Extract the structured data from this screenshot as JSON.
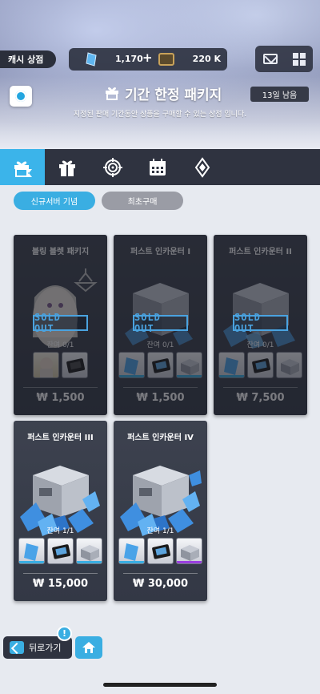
{
  "header": {
    "shop_label": "캐시 상점",
    "currency1_value": "1,170",
    "currency_plus": "+",
    "currency2_value": "220 K",
    "icons": [
      "mail-icon",
      "grid-menu-icon"
    ]
  },
  "title": {
    "text": "기간 한정 패키지",
    "subtitle": "지정된 판매 기간동안 상품을 구매할 수 있는 상점 입니다.",
    "days_left": "13일 남음"
  },
  "tabs": [
    {
      "icon": "limited-package-icon",
      "active": true
    },
    {
      "icon": "gift-icon",
      "active": false
    },
    {
      "icon": "target-icon",
      "active": false
    },
    {
      "icon": "calendar-icon",
      "active": false
    },
    {
      "icon": "diamond-icon",
      "active": false
    }
  ],
  "subtabs": {
    "active": "신규서버 기념",
    "inactive": "최초구매"
  },
  "cards": [
    {
      "title": "블링 블렛 패키지",
      "remaining": "잔여 0/1",
      "price": "₩ 1,500",
      "sold_out": true,
      "stamp": "SOLD OUT"
    },
    {
      "title": "퍼스트 인카운터 I",
      "remaining": "잔여 0/1",
      "price": "₩ 1,500",
      "sold_out": true,
      "stamp": "SOLD OUT"
    },
    {
      "title": "퍼스트 인카운터 II",
      "remaining": "잔여 0/1",
      "price": "₩ 7,500",
      "sold_out": true,
      "stamp": "SOLD OUT"
    },
    {
      "title": "퍼스트 인카운터 III",
      "remaining": "잔여  1/1",
      "price": "₩ 15,000",
      "sold_out": false
    },
    {
      "title": "퍼스트 인카운터 IV",
      "remaining": "잔여  1/1",
      "price": "₩ 30,000",
      "sold_out": false
    }
  ],
  "bottom": {
    "back_label": "뒤로가기",
    "alert": "!"
  },
  "colors": {
    "accent": "#3aaee2",
    "dark_panel": "#2f3340",
    "card": "#3d424f"
  }
}
